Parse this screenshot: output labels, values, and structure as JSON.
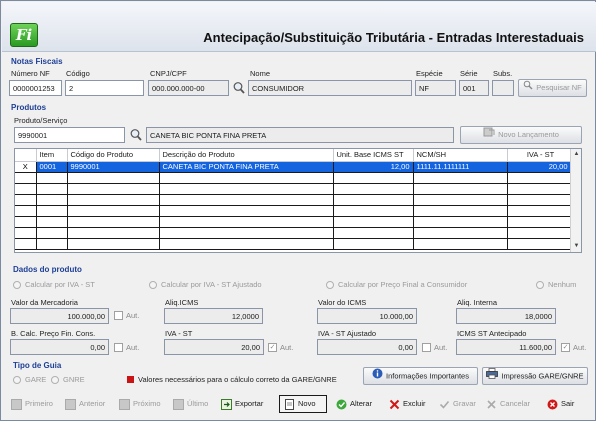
{
  "app": {
    "logo_text": "Fi",
    "title": "Antecipação/Substituição Tributária - Entradas Interestaduais"
  },
  "notas": {
    "section_title": "Notas Fiscais",
    "labels": {
      "numero": "Número NF",
      "codigo": "Código",
      "cnpj": "CNPJ/CPF",
      "nome": "Nome",
      "especie": "Espécie",
      "serie": "Série",
      "subs": "Subs."
    },
    "values": {
      "numero": "0000001253",
      "codigo": "2",
      "cnpj": "000.000.000-00",
      "nome": "CONSUMIDOR",
      "especie": "NF",
      "serie": "001",
      "subs": ""
    },
    "search_button": "Pesquisar NF"
  },
  "produtos": {
    "section_title": "Produtos",
    "label": "Produto/Serviço",
    "codigo": "9990001",
    "descricao": "CANETA BIC PONTA FINA PRETA",
    "novo_button": "Novo Lançamento",
    "grid": {
      "columns": [
        "",
        "Item",
        "Código do Produto",
        "Descrição do Produto",
        "Unit. Base ICMS ST",
        "NCM/SH",
        "IVA - ST"
      ],
      "rows": [
        [
          "X",
          "0001",
          "9990001",
          "CANETA BIC PONTA FINA PRETA",
          "12,00",
          "1111.11.1111111",
          "20,00"
        ]
      ],
      "empty_rows": 7
    }
  },
  "dados": {
    "section_title": "Dados do produto",
    "radios": [
      "Calcular por IVA - ST",
      "Calcular por IVA - ST Ajustado",
      "Calcular por Preço Final a Consumidor",
      "Nenhum"
    ],
    "fields": {
      "valor_mercadoria": {
        "label": "Valor da Mercadoria",
        "value": "100.000,00"
      },
      "aliq_icms": {
        "label": "Aliq.ICMS",
        "value": "12,0000"
      },
      "valor_icms": {
        "label": "Valor do ICMS",
        "value": "10.000,00"
      },
      "aliq_interna": {
        "label": "Aliq. Interna",
        "value": "18,0000"
      },
      "bcalc": {
        "label": "B. Calc. Preço Fin. Cons.",
        "value": "0,00"
      },
      "iva_st": {
        "label": "IVA - ST",
        "value": "20,00"
      },
      "iva_st_ajustado": {
        "label": "IVA - ST Ajustado",
        "value": "0,00"
      },
      "icms_st_antecipado": {
        "label": "ICMS ST Antecipado",
        "value": "11.600,00"
      }
    },
    "aut_label": "Aut.",
    "aut_checked": [
      false,
      false,
      true,
      false,
      false,
      true
    ]
  },
  "guia": {
    "section_title": "Tipo de Guia",
    "options": [
      "GARE",
      "GNRE"
    ],
    "legend": "Valores necessários para o cálculo correto da GARE/GNRE",
    "info_button": "Informações Importantes",
    "print_button": "Impressão GARE/GNRE"
  },
  "toolbar": {
    "primeiro": "Primeiro",
    "anterior": "Anterior",
    "proximo": "Próximo",
    "ultimo": "Último",
    "exportar": "Exportar",
    "novo": "Novo",
    "alterar": "Alterar",
    "excluir": "Excluir",
    "gravar": "Gravar",
    "cancelar": "Cancelar",
    "sair": "Sair"
  },
  "colors": {
    "section_title": "#1e3f96",
    "selection": "#1464e0",
    "legend_marker": "#c81414"
  }
}
